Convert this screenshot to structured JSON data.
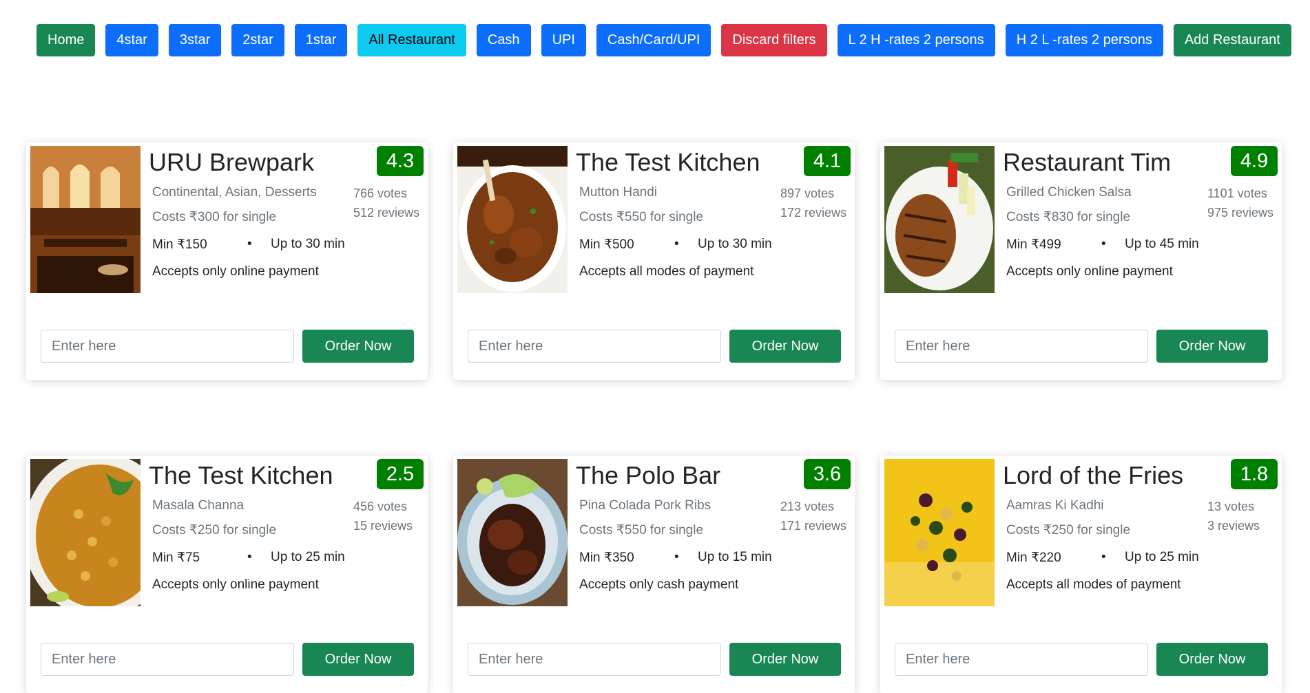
{
  "filters": [
    {
      "label": "Home",
      "style": "success",
      "name": "home-button"
    },
    {
      "label": "4star",
      "style": "primary",
      "name": "filter-4star-button"
    },
    {
      "label": "3star",
      "style": "primary",
      "name": "filter-3star-button"
    },
    {
      "label": "2star",
      "style": "primary",
      "name": "filter-2star-button"
    },
    {
      "label": "1star",
      "style": "primary",
      "name": "filter-1star-button"
    },
    {
      "label": "All Restaurant",
      "style": "info",
      "name": "all-restaurant-button"
    },
    {
      "label": "Cash",
      "style": "primary",
      "name": "filter-cash-button"
    },
    {
      "label": "UPI",
      "style": "primary",
      "name": "filter-upi-button"
    },
    {
      "label": "Cash/Card/UPI",
      "style": "primary",
      "name": "filter-all-payment-button"
    },
    {
      "label": "Discard filters",
      "style": "danger",
      "name": "discard-filters-button"
    },
    {
      "label": "L 2 H -rates 2 persons",
      "style": "primary",
      "name": "sort-low-to-high-button"
    },
    {
      "label": "H 2 L -rates 2 persons",
      "style": "primary",
      "name": "sort-high-to-low-button"
    },
    {
      "label": "Add Restaurant",
      "style": "success",
      "name": "add-restaurant-button"
    }
  ],
  "colors": {
    "success": "#198754",
    "primary": "#0d6efd",
    "info": "#0dcaf0",
    "danger": "#dc3545",
    "rating_badge": "#008000"
  },
  "order": {
    "placeholder": "Enter here",
    "button_label": "Order Now"
  },
  "restaurants": [
    {
      "name": "URU Brewpark",
      "rating": "4.3",
      "cuisine": "Continental, Asian, Desserts",
      "cost": "Costs ₹300 for single",
      "votes": "766 votes",
      "reviews": "512 reviews",
      "min_order": "Min ₹150",
      "separator": "•",
      "delivery": "Up to 30 min",
      "payment": "Accepts only online payment",
      "image": "restaurant-interior-photo"
    },
    {
      "name": "The Test Kitchen",
      "rating": "4.1",
      "cuisine": "Mutton Handi",
      "cost": "Costs ₹550 for single",
      "votes": "897 votes",
      "reviews": "172 reviews",
      "min_order": "Min ₹500",
      "separator": "•",
      "delivery": "Up to 30 min",
      "payment": "Accepts all modes of payment",
      "image": "mutton-curry-photo"
    },
    {
      "name": "Restaurant Tim",
      "rating": "4.9",
      "cuisine": "Grilled Chicken Salsa",
      "cost": "Costs ₹830 for single",
      "votes": "1101 votes",
      "reviews": "975 reviews",
      "min_order": "Min ₹499",
      "separator": "•",
      "delivery": "Up to 45 min",
      "payment": "Accepts only online payment",
      "image": "grilled-chicken-photo"
    },
    {
      "name": "The Test Kitchen",
      "rating": "2.5",
      "cuisine": "Masala Channa",
      "cost": "Costs ₹250 for single",
      "votes": "456 votes",
      "reviews": "15 reviews",
      "min_order": "Min ₹75",
      "separator": "•",
      "delivery": "Up to 25 min",
      "payment": "Accepts only online payment",
      "image": "chana-masala-photo"
    },
    {
      "name": "The Polo Bar",
      "rating": "3.6",
      "cuisine": "Pina Colada Pork Ribs",
      "cost": "Costs ₹550 for single",
      "votes": "213 votes",
      "reviews": "171 reviews",
      "min_order": "Min ₹350",
      "separator": "•",
      "delivery": "Up to 15 min",
      "payment": "Accepts only cash payment",
      "image": "pork-ribs-photo"
    },
    {
      "name": "Lord of the Fries",
      "rating": "1.8",
      "cuisine": "Aamras Ki Kadhi",
      "cost": "Costs ₹250 for single",
      "votes": "13 votes",
      "reviews": "3 reviews",
      "min_order": "Min ₹220",
      "separator": "•",
      "delivery": "Up to 25 min",
      "payment": "Accepts all modes of payment",
      "image": "kadhi-photo"
    }
  ]
}
